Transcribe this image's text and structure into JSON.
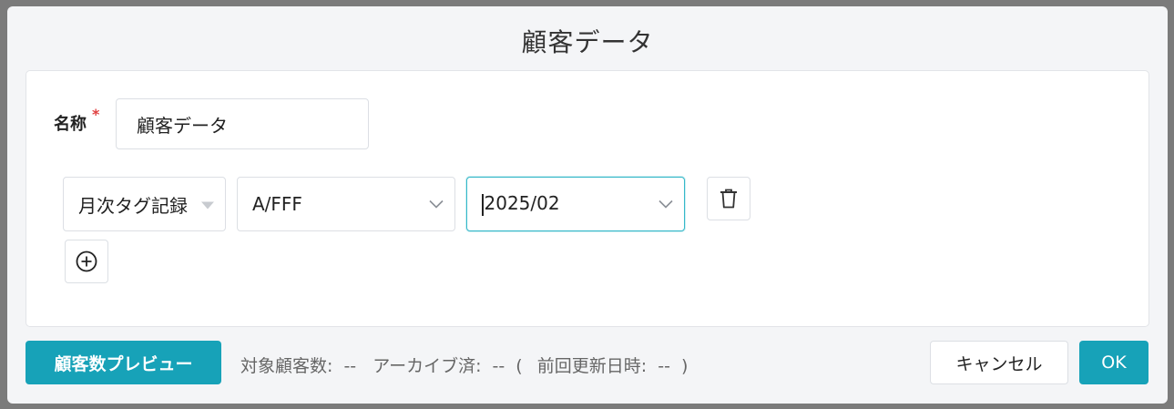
{
  "dialog": {
    "title": "顧客データ"
  },
  "form": {
    "name_label": "名称",
    "required_mark": "*",
    "name_value": "顧客データ"
  },
  "condition": {
    "type_select": "月次タグ記録",
    "tag_select": "A/FFF",
    "month_select": "2025/02"
  },
  "footer": {
    "preview_label": "顧客数プレビュー",
    "target_label": "対象顧客数:",
    "target_value": "--",
    "archived_label": "アーカイブ済:",
    "archived_value": "--",
    "paren_open": "(",
    "updated_label": "前回更新日時:",
    "updated_value": "--",
    "paren_close": ")",
    "cancel_label": "キャンセル",
    "ok_label": "OK"
  },
  "icons": {
    "delete": "trash-icon",
    "add": "plus-circle-icon",
    "caret": "chevron-down-icon"
  },
  "colors": {
    "primary": "#17a2b8",
    "focus_border": "#35b8c9",
    "required": "#e04040"
  }
}
